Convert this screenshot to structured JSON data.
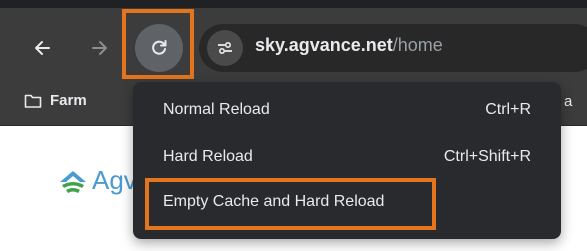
{
  "toolbar": {
    "back_icon": "arrow-left-icon",
    "forward_icon": "arrow-right-icon",
    "reload_icon": "reload-icon",
    "site_info_icon": "tune-icon"
  },
  "address_bar": {
    "host": "sky.agvance.net",
    "path": "/home"
  },
  "bookmarks": {
    "folder_label": "Farm",
    "folder_icon": "folder-icon",
    "overflow_fragment": "a"
  },
  "page": {
    "logo_text": "Agv"
  },
  "reload_menu": {
    "items": [
      {
        "label": "Normal Reload",
        "shortcut": "Ctrl+R"
      },
      {
        "label": "Hard Reload",
        "shortcut": "Ctrl+Shift+R"
      },
      {
        "label": "Empty Cache and Hard Reload",
        "shortcut": ""
      }
    ]
  },
  "colors": {
    "highlight": "#e4751c",
    "toolbar_bg": "#3c3c3c",
    "menu_bg": "#292a2d",
    "logo_blue": "#4a9bd0",
    "logo_green": "#3fa34d"
  }
}
